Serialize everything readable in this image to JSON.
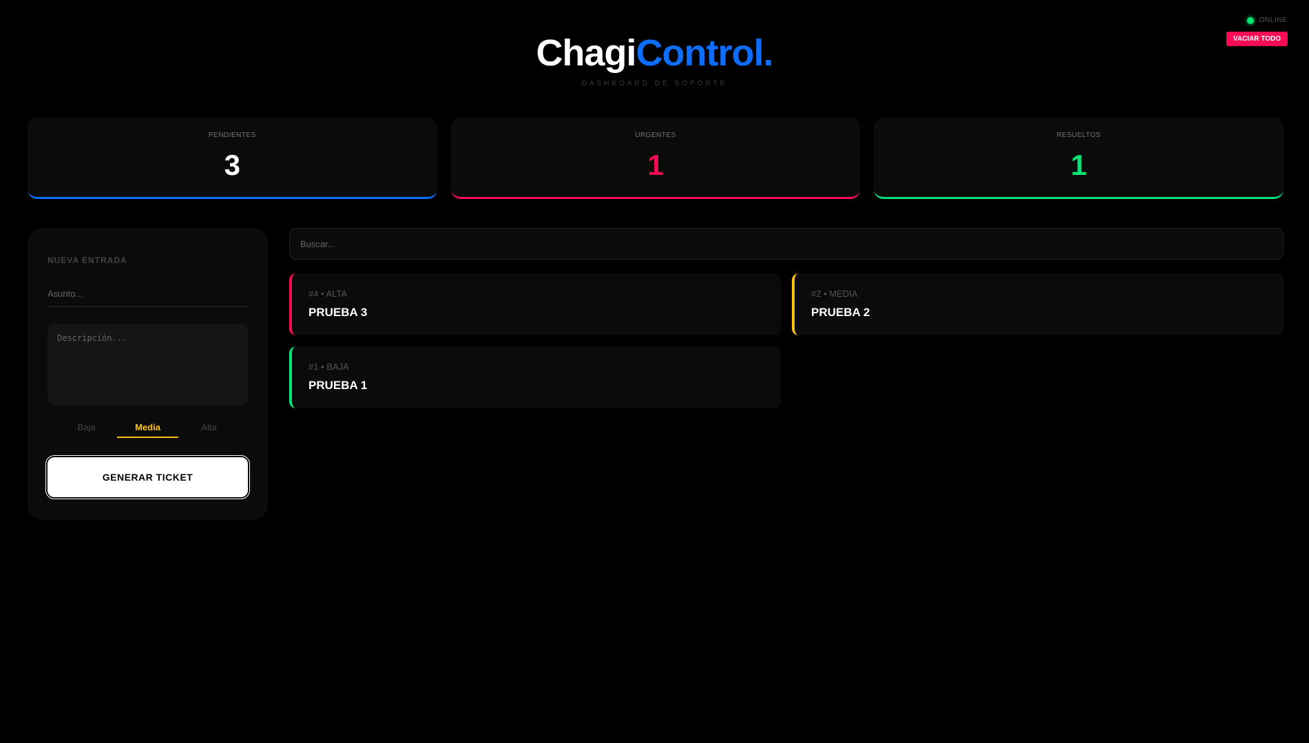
{
  "status": {
    "label": "ONLINE",
    "color": "#00e676"
  },
  "header": {
    "logo_part1": "Chagi",
    "logo_part2": "Control.",
    "subtitle": "DASHBOARD DE SOPORTE",
    "clear_button": "VACIAR TODO"
  },
  "stats": [
    {
      "label": "PENDIENTES",
      "value": "3",
      "color": "#0d6efd"
    },
    {
      "label": "URGENTES",
      "value": "1",
      "color": "#ff0a54"
    },
    {
      "label": "RESUELTOS",
      "value": "1",
      "color": "#00e676"
    }
  ],
  "form": {
    "title": "NUEVA ENTRADA",
    "subject_placeholder": "Asunto...",
    "subject_value": "",
    "description_placeholder": "Descripción...",
    "description_value": "",
    "priorities": [
      "Baja",
      "Media",
      "Alta"
    ],
    "selected_priority": "Media",
    "submit_label": "GENERAR TICKET"
  },
  "search": {
    "placeholder": "Buscar...",
    "value": ""
  },
  "tickets": [
    {
      "meta": "#4 • ALTA",
      "title": "PRUEBA 3",
      "priority": "alta"
    },
    {
      "meta": "#2 • MEDIA",
      "title": "PRUEBA 2",
      "priority": "media"
    },
    {
      "meta": "#1 • BAJA",
      "title": "PRUEBA 1",
      "priority": "baja"
    }
  ],
  "colors": {
    "accent_blue": "#0d6efd",
    "accent_red": "#ff0a54",
    "accent_yellow": "#ffc20e",
    "accent_green": "#00e676"
  }
}
